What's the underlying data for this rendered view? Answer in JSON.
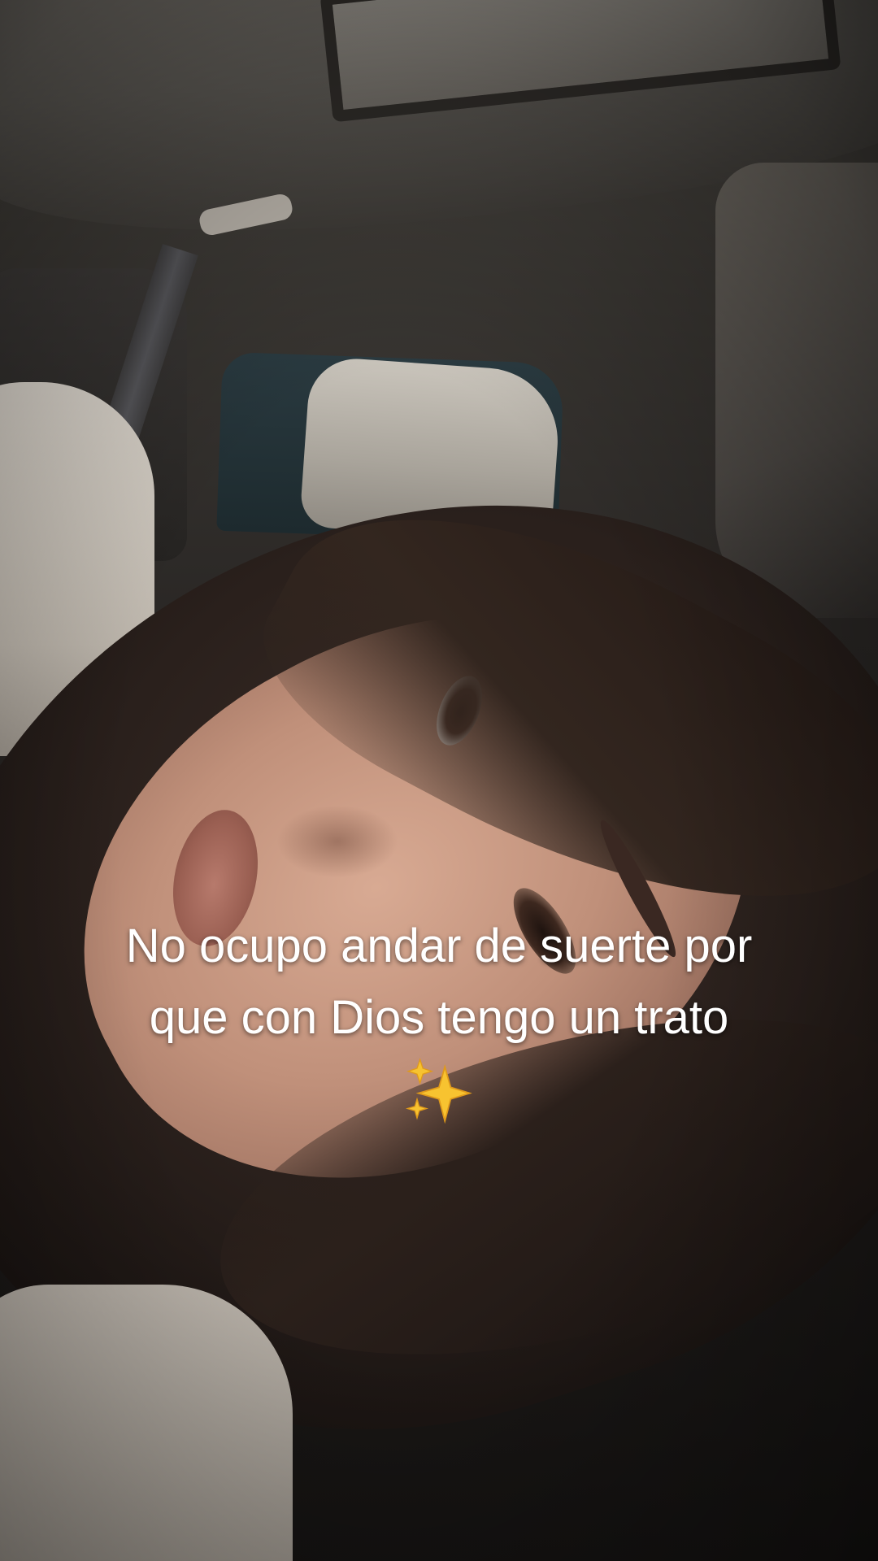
{
  "caption": {
    "line1": "No ocupo andar de suerte por",
    "line2": "que con Dios tengo un trato",
    "emoji": "sparkles-emoji"
  },
  "colors": {
    "caption_text": "#ffffff",
    "sparkle_gold": "#f7c330"
  }
}
